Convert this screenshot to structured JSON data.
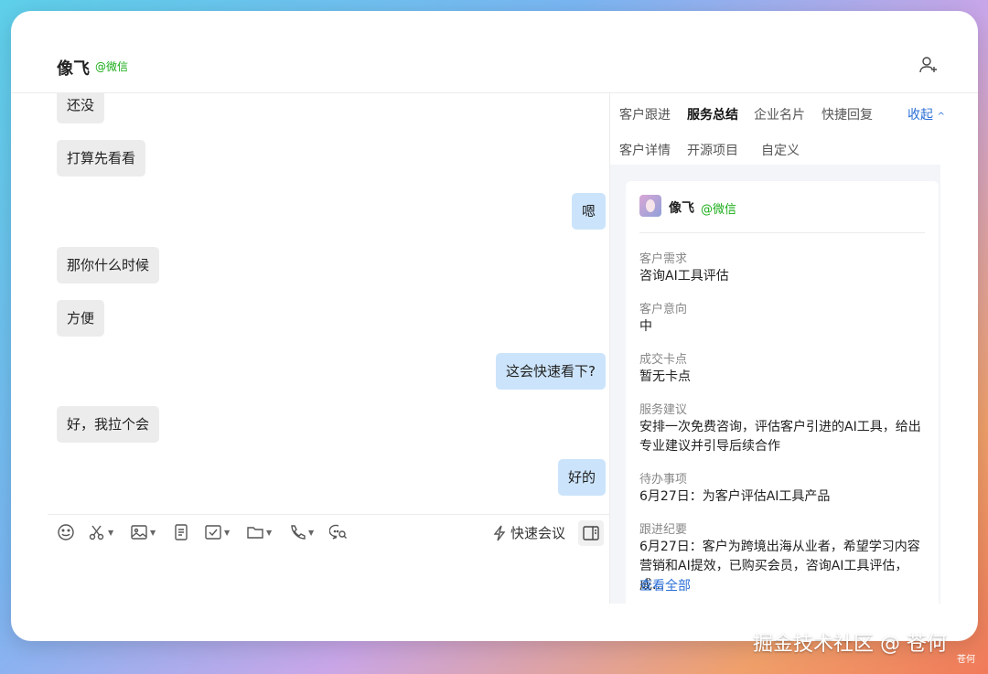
{
  "header": {
    "contact_name": "像飞",
    "contact_source": "@微信"
  },
  "chat": {
    "messages": [
      {
        "text": "还没",
        "direction": "in"
      },
      {
        "text": "打算先看看",
        "direction": "in"
      },
      {
        "text": "嗯",
        "direction": "out"
      },
      {
        "text": "那你什么时候",
        "direction": "in"
      },
      {
        "text": "方便",
        "direction": "in"
      },
      {
        "text": "这会快速看下?",
        "direction": "out"
      },
      {
        "text": "好，我拉个会",
        "direction": "in"
      },
      {
        "text": "好的",
        "direction": "out"
      }
    ]
  },
  "toolbar": {
    "icons": [
      "emoji-icon",
      "scissors-icon",
      "image-icon",
      "document-icon",
      "checklist-icon",
      "folder-icon",
      "phone-icon",
      "chat-search-icon"
    ],
    "quick_meeting_label": "快速会议"
  },
  "side_panel": {
    "tabs": [
      "客户跟进",
      "服务总结",
      "企业名片",
      "快捷回复",
      "客户详情",
      "开源项目",
      "自定义"
    ],
    "active_tab": "服务总结",
    "collapse_label": "收起",
    "card": {
      "name": "像飞",
      "source": "@微信",
      "fields": [
        {
          "label": "客户需求",
          "value": "咨询AI工具评估"
        },
        {
          "label": "客户意向",
          "value": "中"
        },
        {
          "label": "成交卡点",
          "value": "暂无卡点"
        },
        {
          "label": "服务建议",
          "value": "安排一次免费咨询，评估客户引进的AI工具，给出专业建议并引导后续合作"
        },
        {
          "label": "待办事项",
          "value": "6月27日：为客户评估AI工具产品"
        },
        {
          "label": "跟进纪要",
          "value": "6月27日：客户为跨境出海从业者，希望学习内容营销和AI提效，已购买会员，咨询AI工具评估，成..."
        }
      ],
      "view_all_label": "查看全部"
    }
  },
  "watermark": {
    "text": "掘金技术社区 @ 苍何",
    "small": "苍何"
  },
  "colors": {
    "accent_blue": "#2c6fd6",
    "wechat_green": "#1aad19",
    "outgoing_bubble": "#cce4fb",
    "incoming_bubble": "#ececec"
  }
}
